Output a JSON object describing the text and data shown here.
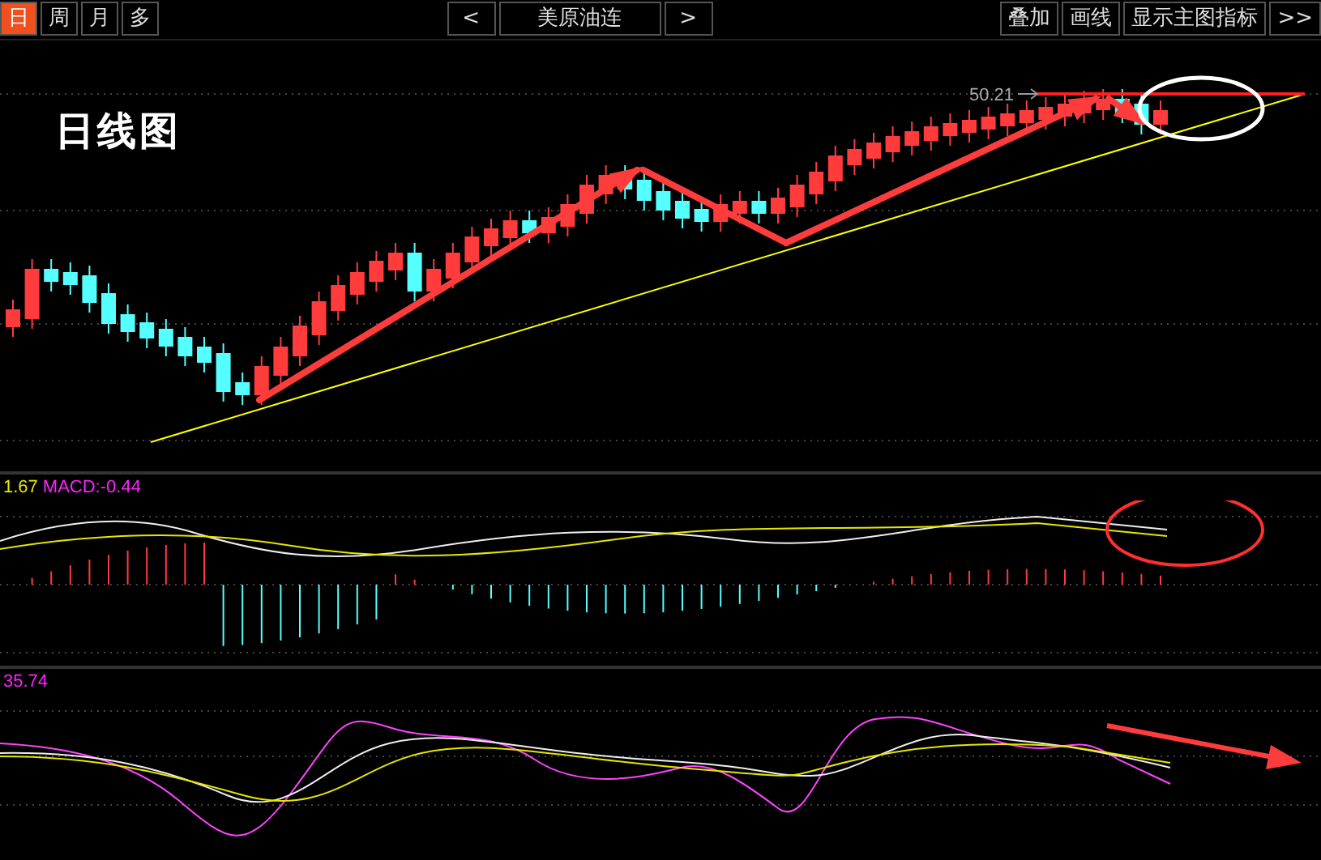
{
  "toolbar": {
    "periods": [
      {
        "label": "日",
        "selected": true
      },
      {
        "label": "周",
        "selected": false
      },
      {
        "label": "月",
        "selected": false
      },
      {
        "label": "多",
        "selected": false
      }
    ],
    "prev": "<",
    "stock": "美原油连",
    "next": ">",
    "actions": [
      "叠加",
      "画线",
      "显示主图指标",
      ">>"
    ]
  },
  "main_chart": {
    "annotation": "日线图",
    "price_label": "50.21"
  },
  "macd_panel": {
    "value": "1.67",
    "label": "MACD:-0.44"
  },
  "kdj_panel": {
    "value": "35.74"
  }
}
